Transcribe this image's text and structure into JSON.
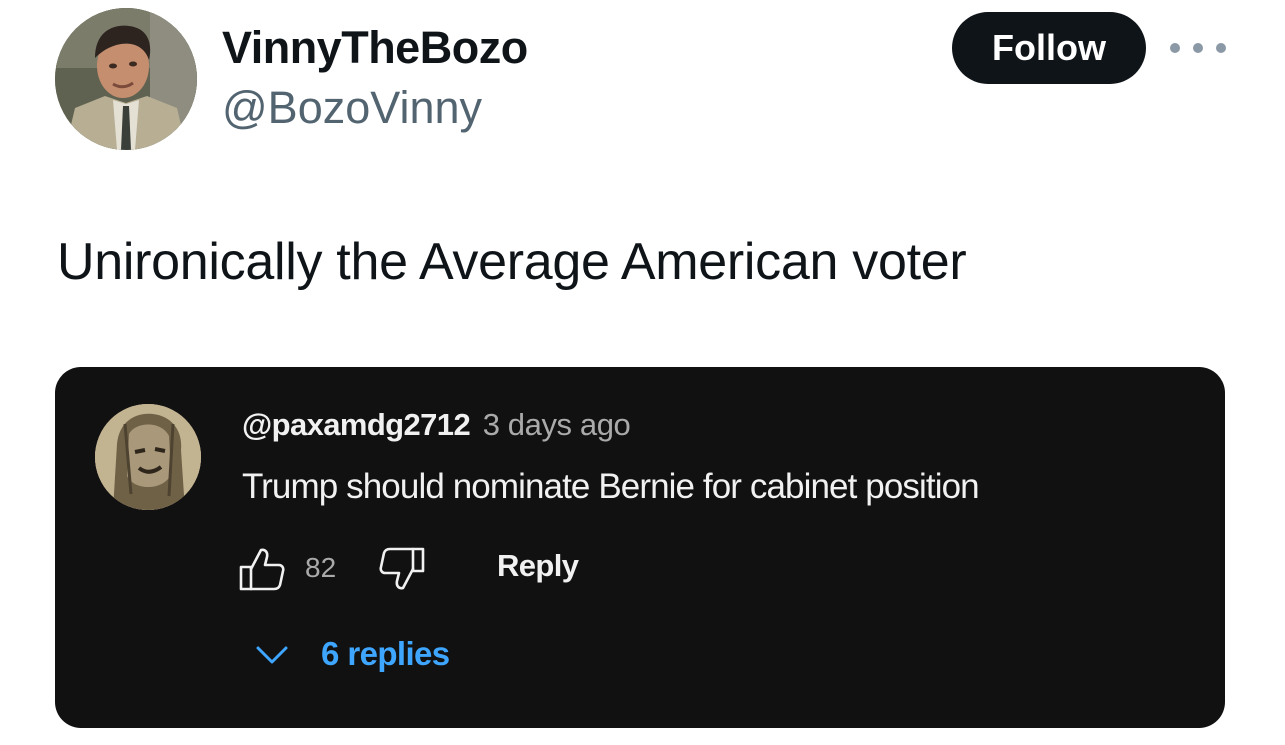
{
  "tweet": {
    "author": {
      "display_name": "VinnyTheBozo",
      "handle": "@BozoVinny"
    },
    "follow_label": "Follow",
    "more_icon": "more-horizontal-icon",
    "text": "Unironically the Average American voter"
  },
  "embedded_comment": {
    "author": "@paxamdg2712",
    "timestamp": "3 days ago",
    "text": "Trump should nominate Bernie for cabinet position",
    "like_count": "82",
    "like_icon": "thumbs-up-icon",
    "dislike_icon": "thumbs-down-icon",
    "reply_label": "Reply",
    "replies_label": "6 replies",
    "replies_icon": "chevron-down-icon"
  },
  "colors": {
    "text_primary": "#0f1419",
    "text_secondary": "#536471",
    "follow_button_bg": "#0f1419",
    "embed_bg": "#111111",
    "replies_link": "#3ea6ff"
  }
}
